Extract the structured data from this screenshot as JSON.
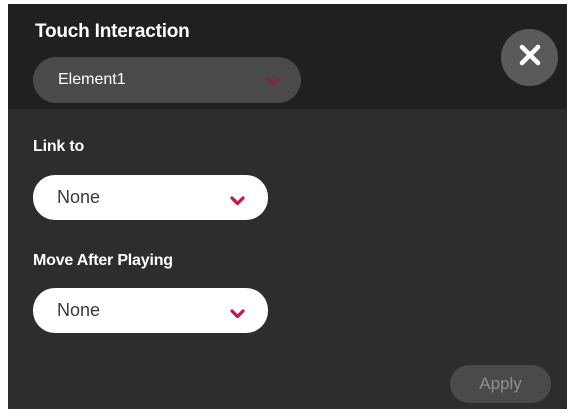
{
  "dialog": {
    "title": "Touch Interaction",
    "element_select": {
      "value": "Element1"
    },
    "close_icon": "close-icon",
    "fields": [
      {
        "label": "Link to",
        "value": "None"
      },
      {
        "label": "Move After Playing",
        "value": "None"
      }
    ],
    "apply_label": "Apply"
  },
  "colors": {
    "accent": "#c8134b",
    "panel": "#2d2d2d",
    "header": "#202020"
  }
}
